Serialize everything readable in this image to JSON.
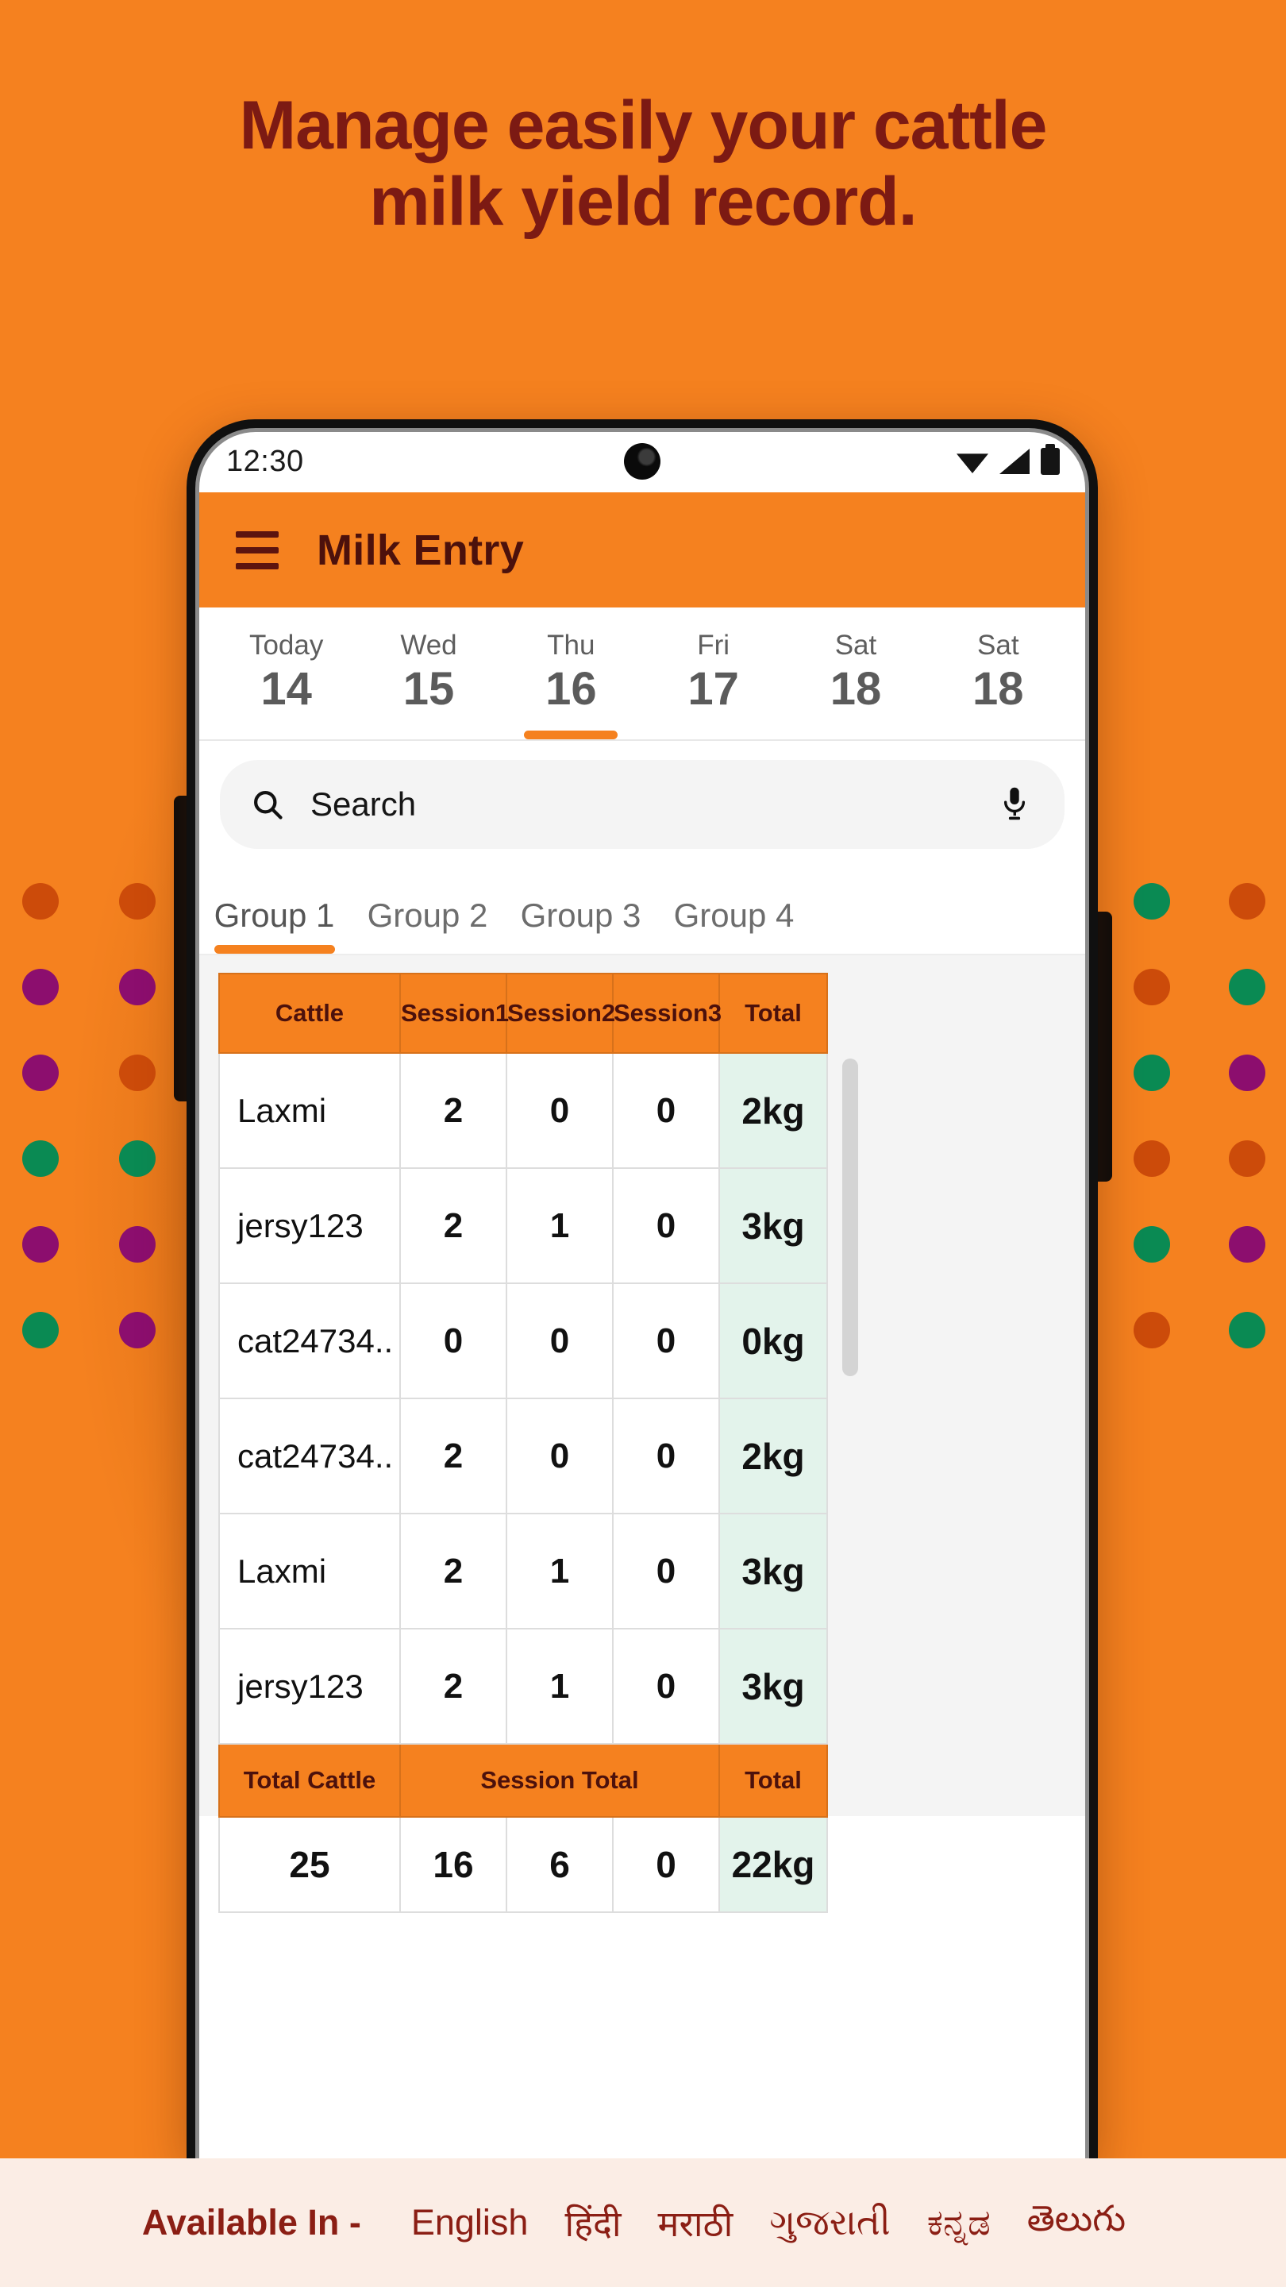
{
  "promo": {
    "headline": "Manage easily your cattle\nmilk yield record.",
    "headline_color": "#7C1A13",
    "background_color": "#F5811F"
  },
  "decor_dots": {
    "colors": {
      "orange": "#CC4B0A",
      "purple": "#8C0E6E",
      "green": "#0A8A53"
    },
    "left_column_1": [
      "orange",
      "purple",
      "purple",
      "green",
      "purple",
      "green"
    ],
    "left_column_2": [
      "orange",
      "purple",
      "orange",
      "green",
      "purple",
      "purple"
    ],
    "right_column_1": [
      "green",
      "orange",
      "green",
      "orange",
      "green",
      "orange"
    ],
    "right_column_2": [
      "orange",
      "green",
      "purple",
      "orange",
      "purple",
      "green"
    ]
  },
  "status_bar": {
    "time": "12:30",
    "icons": [
      "wifi-icon",
      "signal-icon",
      "battery-icon"
    ]
  },
  "app_bar": {
    "menu_icon": "hamburger-menu-icon",
    "title": "Milk Entry",
    "background_color": "#F5811F",
    "title_color": "#4C110C"
  },
  "date_strip": {
    "days": [
      {
        "dow": "Today",
        "num": "14",
        "selected": false
      },
      {
        "dow": "Wed",
        "num": "15",
        "selected": false
      },
      {
        "dow": "Thu",
        "num": "16",
        "selected": true
      },
      {
        "dow": "Fri",
        "num": "17",
        "selected": false
      },
      {
        "dow": "Sat",
        "num": "18",
        "selected": false
      },
      {
        "dow": "Sat",
        "num": "18",
        "selected": false
      }
    ]
  },
  "search": {
    "placeholder": "Search",
    "value": "",
    "leading_icon": "search-icon",
    "trailing_icon": "microphone-icon"
  },
  "group_tabs": {
    "items": [
      {
        "label": "Group 1",
        "selected": true
      },
      {
        "label": "Group 2",
        "selected": false
      },
      {
        "label": "Group 3",
        "selected": false
      },
      {
        "label": "Group 4",
        "selected": false
      }
    ]
  },
  "milk_table": {
    "headers": [
      "Cattle",
      "Session1",
      "Session2",
      "Session3",
      "Total"
    ],
    "rows": [
      {
        "cattle": "Laxmi",
        "s1": "2",
        "s2": "0",
        "s3": "0",
        "total": "2kg"
      },
      {
        "cattle": "jersy123",
        "s1": "2",
        "s2": "1",
        "s3": "0",
        "total": "3kg"
      },
      {
        "cattle": "cat24734..",
        "s1": "0",
        "s2": "0",
        "s3": "0",
        "total": "0kg"
      },
      {
        "cattle": "cat24734..",
        "s1": "2",
        "s2": "0",
        "s3": "0",
        "total": "2kg"
      },
      {
        "cattle": "Laxmi",
        "s1": "2",
        "s2": "1",
        "s3": "0",
        "total": "3kg"
      },
      {
        "cattle": "jersy123",
        "s1": "2",
        "s2": "1",
        "s3": "0",
        "total": "3kg"
      }
    ],
    "footer_headers": [
      "Total Cattle",
      "Session Total",
      "Total"
    ],
    "footer_values": {
      "total_cattle": "25",
      "session1": "16",
      "session2": "6",
      "session3": "0",
      "total": "22kg"
    },
    "header_bg": "#F5811F",
    "total_cell_bg": "#E3F3EB"
  },
  "footer": {
    "label": "Available In -",
    "languages": [
      "English",
      "हिंदी",
      "मराठी",
      "ગુજરાતી",
      "ಕನ್ನಡ",
      "తెలుగు"
    ],
    "background_color": "#FBEDE5",
    "text_color": "#8B1E14"
  }
}
